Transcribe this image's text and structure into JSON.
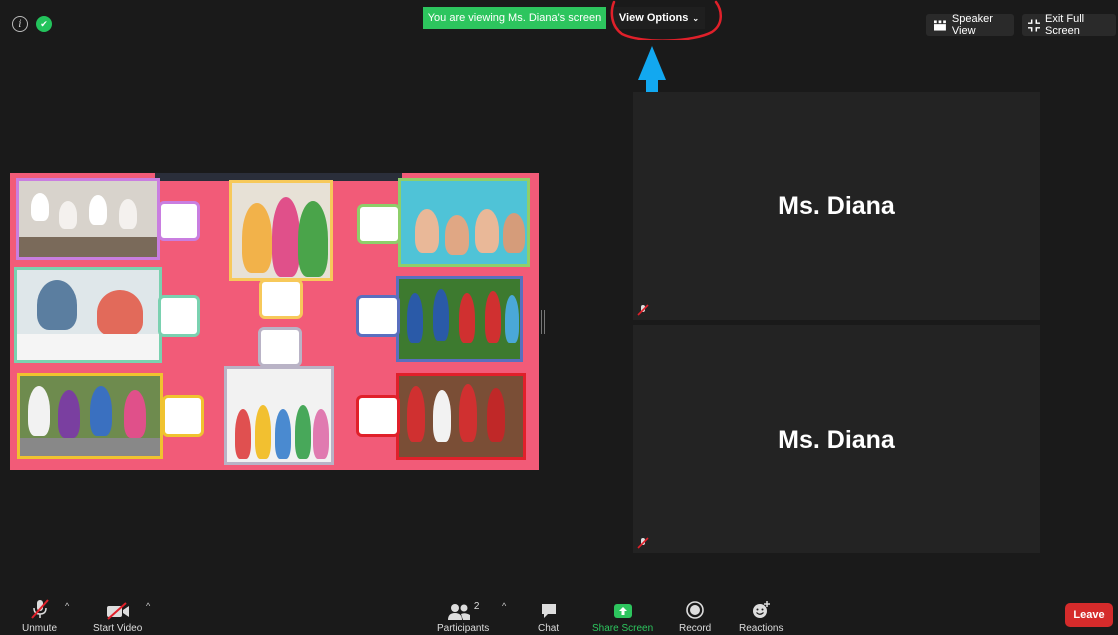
{
  "top_bar": {
    "viewing_banner": "You are viewing Ms. Diana's screen",
    "view_options_label": "View Options",
    "speaker_view_label": "Speaker View",
    "exit_fullscreen_label": "Exit Full Screen"
  },
  "participants": [
    {
      "name": "Ms. Diana",
      "audio": "muted"
    },
    {
      "name": "Ms. Diana",
      "audio": "muted"
    }
  ],
  "toolbar": {
    "unmute_label": "Unmute",
    "start_video_label": "Start Video",
    "participants_label": "Participants",
    "participants_count": "2",
    "chat_label": "Chat",
    "share_screen_label": "Share Screen",
    "record_label": "Record",
    "reactions_label": "Reactions",
    "leave_label": "Leave"
  },
  "colors": {
    "banner_green": "#2dc55e",
    "share_green": "#2dc55e",
    "leave_red": "#d52b2b",
    "slide_pink": "#f25b78",
    "annotation_red": "#e0202a",
    "annotation_blue": "#12a8f0"
  },
  "icons": [
    "info-icon",
    "shield-icon",
    "chevron-down-icon",
    "speaker-view-icon",
    "exit-fullscreen-icon",
    "mic-muted-icon",
    "video-off-icon",
    "participants-icon",
    "chat-icon",
    "share-screen-icon",
    "record-icon",
    "reactions-icon"
  ]
}
